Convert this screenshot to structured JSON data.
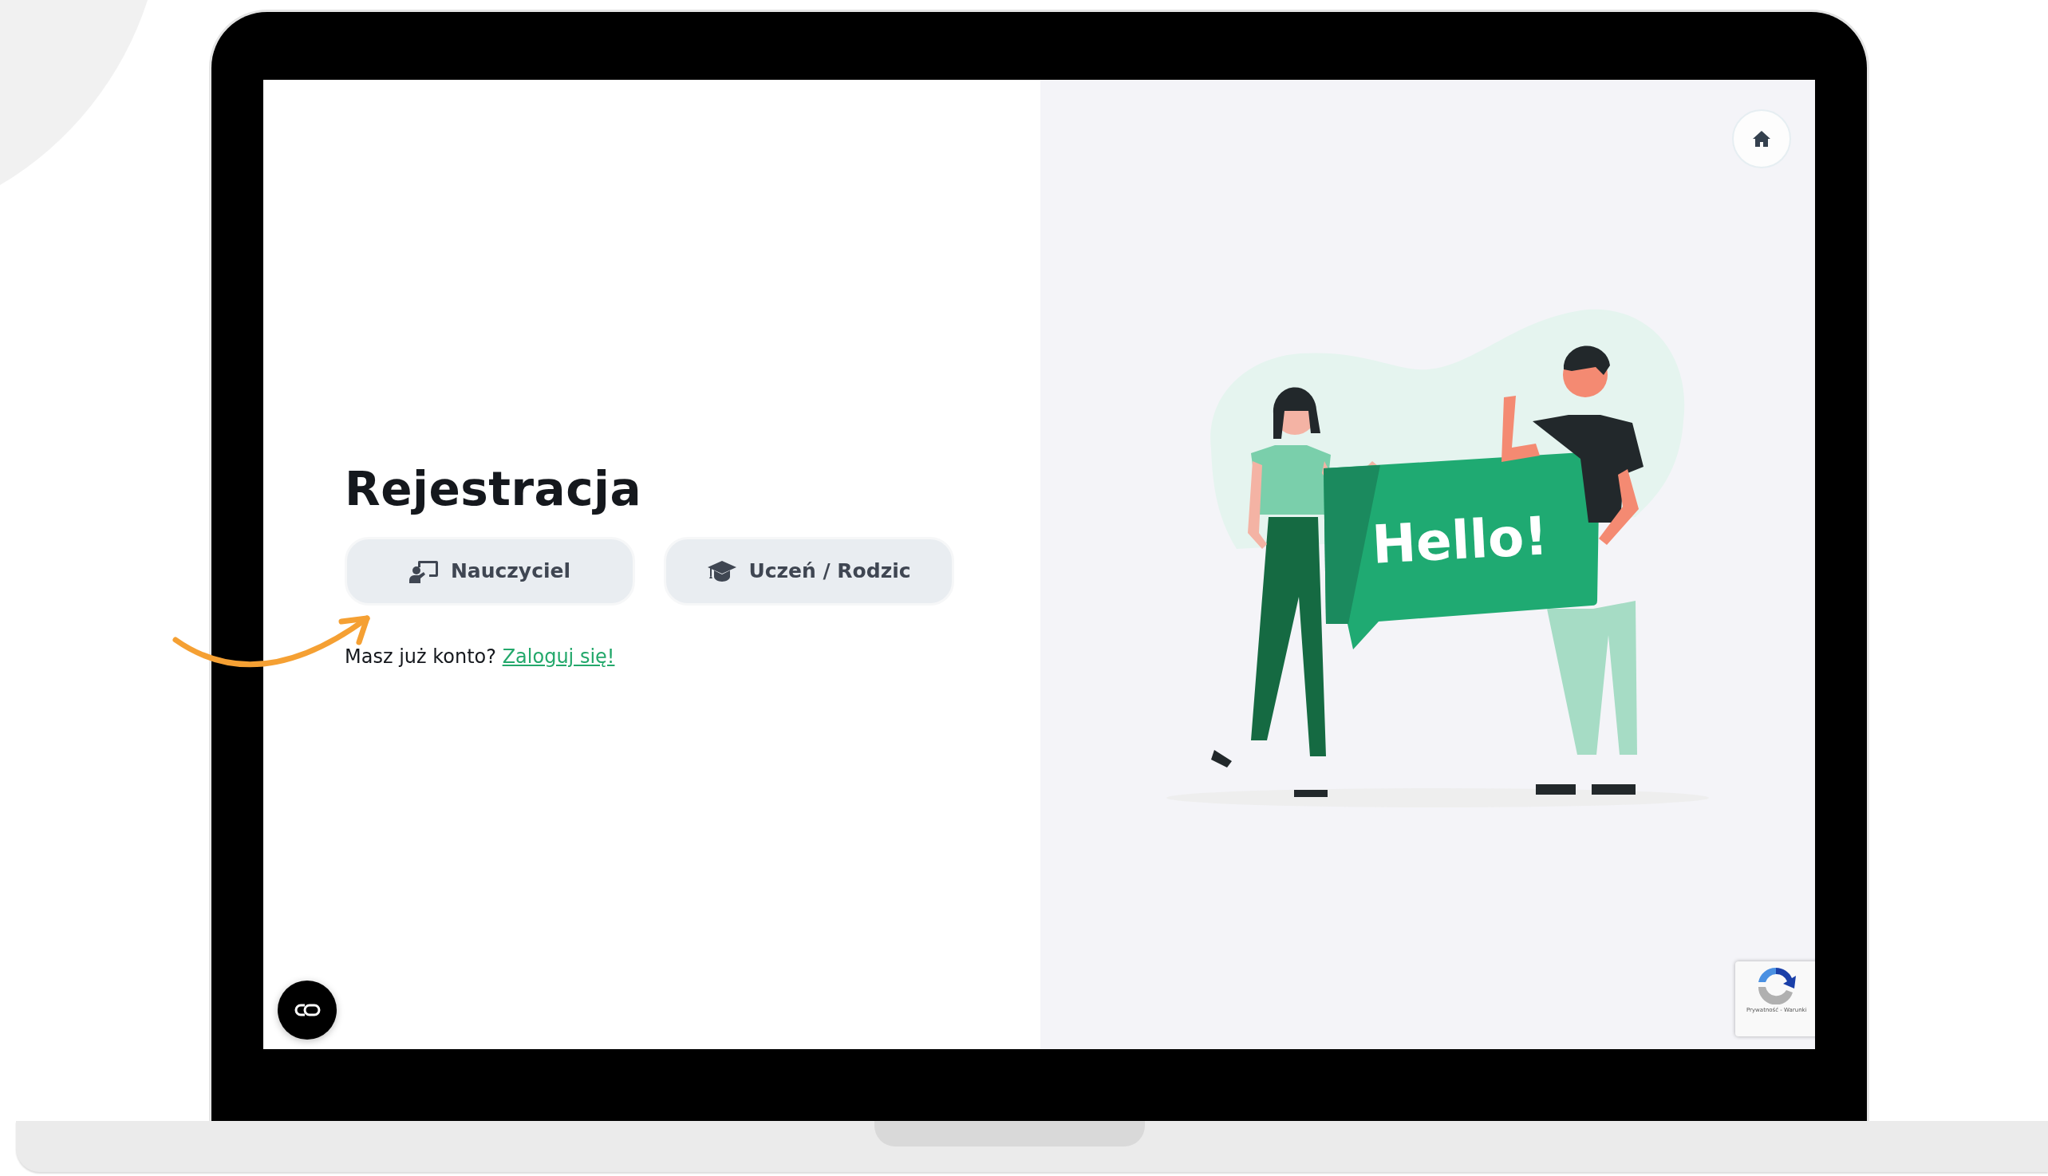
{
  "signup": {
    "title": "Rejestracja",
    "roles": [
      {
        "kind": "teacher",
        "label": "Nauczyciel"
      },
      {
        "kind": "student",
        "label": "Uczeń / Rodzic"
      }
    ],
    "login_prompt": {
      "text": "Masz już konto?",
      "link": "Zaloguj się!"
    }
  },
  "illustration": {
    "banner_text": "Hello!"
  },
  "recaptcha": {
    "text": "Prywatność - Warunki"
  }
}
